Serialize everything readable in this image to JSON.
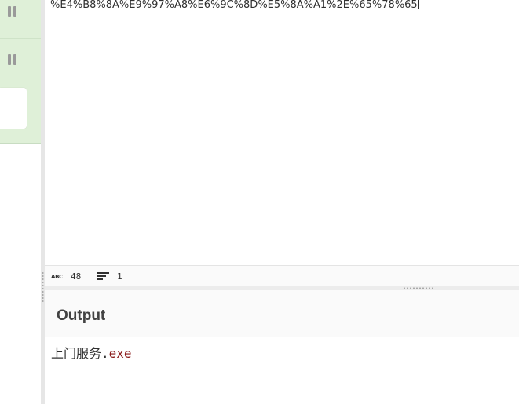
{
  "input": {
    "text": "%E4%B8%8A%E9%97%A8%E6%9C%8D%E5%8A%A1%2E%65%78%65"
  },
  "status": {
    "chars_icon": "ABC",
    "chars_count": "48",
    "lines_icon": "lines-icon",
    "lines_count": "1"
  },
  "output": {
    "title": "Output",
    "text_main": "上门服务",
    "text_dot": ".",
    "text_ext": "exe"
  },
  "colors": {
    "recipe_green": "#dff0d8",
    "ext_highlight": "#8b1a1a"
  }
}
